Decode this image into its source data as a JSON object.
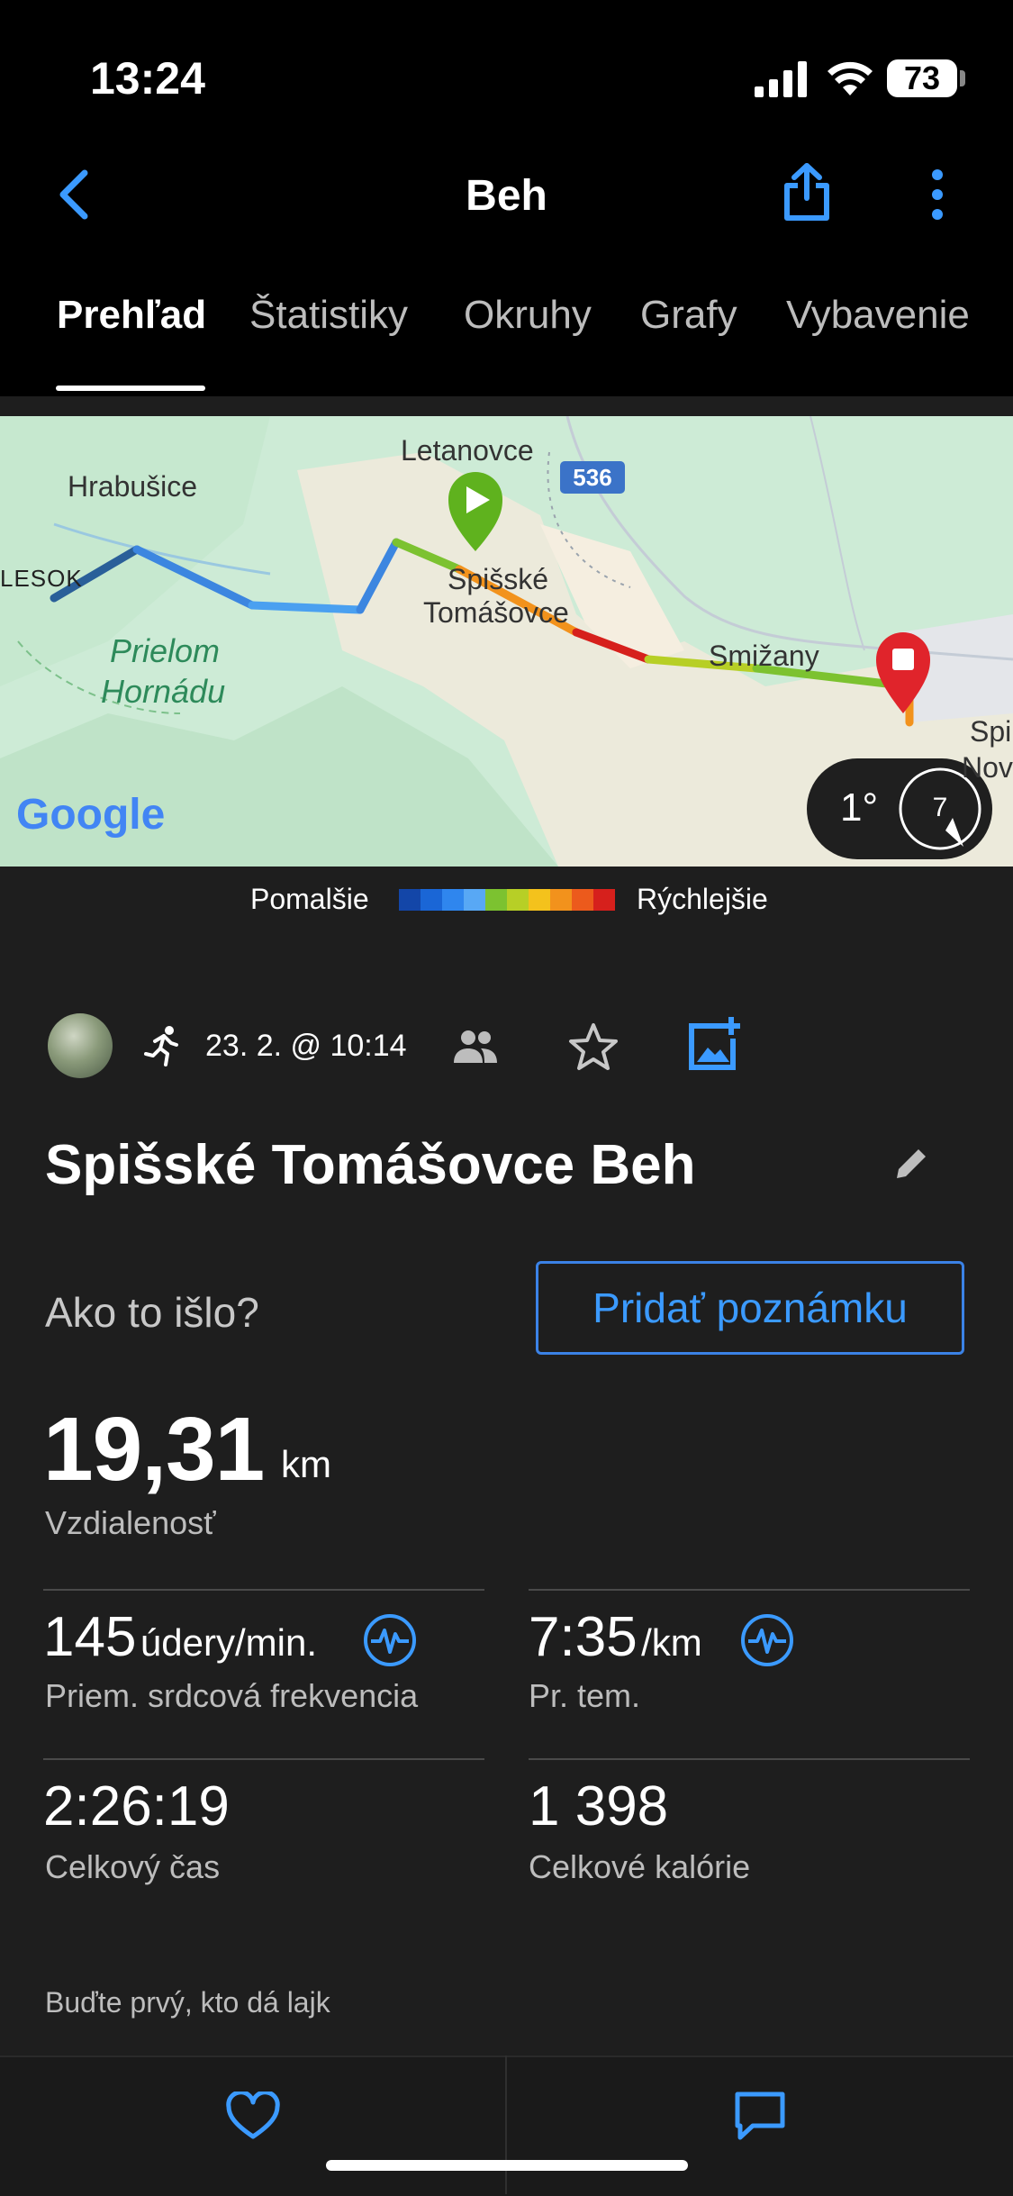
{
  "status_bar": {
    "time": "13:24",
    "battery": "73"
  },
  "nav": {
    "title": "Beh",
    "back_icon": "chevron-left-icon",
    "share_icon": "share-icon",
    "more_icon": "more-vertical-icon"
  },
  "tabs": [
    {
      "label": "Prehľad",
      "active": true
    },
    {
      "label": "Štatistiky",
      "active": false
    },
    {
      "label": "Okruhy",
      "active": false
    },
    {
      "label": "Grafy",
      "active": false
    },
    {
      "label": "Vybavenie",
      "active": false
    }
  ],
  "map": {
    "places": {
      "letanovce": "Letanovce",
      "hrabusice": "Hrabušice",
      "lesok": "LESOK",
      "prielom1": "Prielom",
      "prielom2": "Hornádu",
      "spisske1": "Spišské",
      "spisske2": "Tomášovce",
      "smizany": "Smižany",
      "spi": "Spi",
      "nov": "Nov"
    },
    "road_badge": "536",
    "attribution": "Google",
    "weather_temp": "1°",
    "wind_speed": "7"
  },
  "legend": {
    "slower": "Pomalšie",
    "faster": "Rýchlejšie",
    "colors": [
      "#1346a8",
      "#1a66d6",
      "#2f86ee",
      "#58a8f5",
      "#7cc230",
      "#b7cf26",
      "#f4c21c",
      "#f2921c",
      "#ec5a1c",
      "#d6201c"
    ]
  },
  "activity": {
    "date_time": "23. 2. @ 10:14",
    "title": "Spišské Tomášovce Beh",
    "question": "Ako to išlo?",
    "add_note": "Pridať poznámku",
    "distance": {
      "value": "19,31",
      "unit": "km",
      "label": "Vzdialenosť"
    },
    "heart_rate": {
      "value": "145",
      "unit": "údery/min.",
      "label": "Priem. srdcová frekvencia"
    },
    "pace": {
      "value": "7:35",
      "unit": "/km",
      "label": "Pr. tem."
    },
    "total_time": {
      "value": "2:26:19",
      "label": "Celkový čas"
    },
    "calories": {
      "value": "1 398",
      "label": "Celkové kalórie"
    },
    "like_prompt": "Buďte prvý, kto dá lajk"
  },
  "colors": {
    "accent": "#3b9aff",
    "start": "#5fb21e",
    "end": "#e0242b"
  }
}
